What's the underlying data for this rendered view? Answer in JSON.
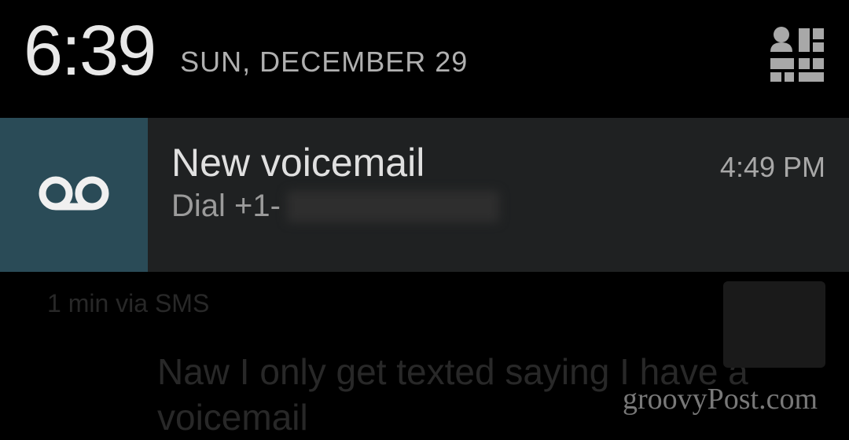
{
  "header": {
    "time": "6:39",
    "date": "SUN, DECEMBER 29"
  },
  "notification": {
    "title": "New voicemail",
    "subtitle_prefix": "Dial +1-",
    "timestamp": "4:49 PM"
  },
  "background": {
    "meta": "1 min via SMS",
    "message": "Naw I only get texted saying I have a voicemail"
  },
  "watermark": "groovyPost.com"
}
